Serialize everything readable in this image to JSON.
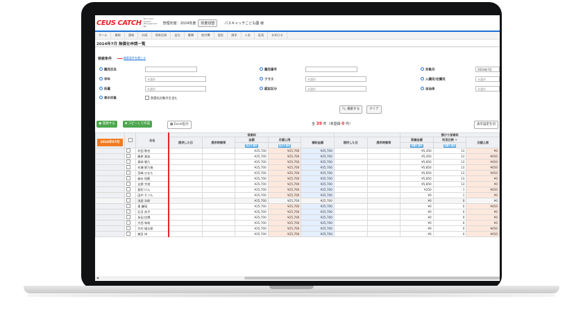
{
  "header": {
    "logo_text": "CEUS CATCH",
    "logo_subtitle": "Nice Care System Management Bit",
    "period_label": "管理年度：2024年度",
    "switch_button": "年度切替",
    "school_name": "パスキャッチこども園 様"
  },
  "nav": [
    "ホーム",
    "業務",
    "連絡",
    "計画",
    "保育記録",
    "出欠",
    "書類",
    "給付費",
    "設定",
    "請求",
    "入金",
    "延長",
    "お知らせ"
  ],
  "page_title": "2024年7月 無償化申請一覧",
  "conditions": {
    "heading": "検索条件",
    "toggle_link": "検索条件を閉じる",
    "fields": [
      {
        "label": "園児氏名",
        "value": ""
      },
      {
        "label": "園児番号",
        "value": ""
      },
      {
        "label": "対象月",
        "value": "2024年7月"
      },
      {
        "label": "学年",
        "value": "未選択"
      },
      {
        "label": "クラス",
        "value": "未選択"
      },
      {
        "label": "入園児/在園児",
        "value": "未選択"
      },
      {
        "label": "所属",
        "value": "未選択"
      },
      {
        "label": "認定区分",
        "value": "未選択"
      },
      {
        "label": "自治体",
        "value": "未選択"
      }
    ],
    "display_label": "表示対象",
    "display_checkbox": "無償化対象外を含む",
    "search_button": "検索する",
    "clear_button": "クリア"
  },
  "results": {
    "count_prefix": "全",
    "count": "39",
    "count_suffix": "件（未登録",
    "unregistered": "0",
    "count_end": "件）"
  },
  "actions": {
    "register": "登録する",
    "copy": "コピーして作成",
    "excel": "Excel出力",
    "display_settings": "表示設定を切"
  },
  "table": {
    "month_badge": "2024年07月",
    "group_headers": {
      "hoiku": "保育料",
      "azukari": "預かり保育料"
    },
    "columns": [
      "氏名",
      "提供した日",
      "提供時間帯",
      "金額",
      "月額上限",
      "補助金額",
      "提供した日",
      "提供時間帯",
      "実績金額",
      "利用日数 ÷",
      "日額上限"
    ],
    "sub_buttons": {
      "kingaku": "設定を適用",
      "gakugen": "設定を適用",
      "jisseki": "実績を適用",
      "riyou": "実績を適用"
    },
    "rows": [
      {
        "name": "村田 数也",
        "amount": "¥25,700",
        "limit": "¥25,700",
        "subsidy": "¥25,700",
        "actual": "¥5,450",
        "days": "13",
        "daily": "¥0"
      },
      {
        "name": "藤原 真苗",
        "amount": "¥25,700",
        "limit": "¥25,700",
        "subsidy": "¥25,700",
        "actual": "¥5,450",
        "days": "13",
        "daily": "¥450"
      },
      {
        "name": "青崎 朝乃",
        "amount": "¥25,700",
        "limit": "¥25,700",
        "subsidy": "¥25,700",
        "actual": "¥5,850",
        "days": "13",
        "daily": "¥450"
      },
      {
        "name": "村瀬 那乃香",
        "amount": "¥25,700",
        "limit": "¥25,700",
        "subsidy": "¥25,700",
        "actual": "¥5,850",
        "days": "13",
        "daily": "¥450"
      },
      {
        "name": "宮嶋 ひなた",
        "amount": "¥25,700",
        "limit": "¥25,700",
        "subsidy": "¥25,700",
        "actual": "¥5,850",
        "days": "13",
        "daily": "¥450"
      },
      {
        "name": "森永 拓範",
        "amount": "¥25,700",
        "limit": "¥25,700",
        "subsidy": "¥25,700",
        "actual": "¥5,850",
        "days": "13",
        "daily": "¥0"
      },
      {
        "name": "吉野 大地",
        "amount": "¥25,700",
        "limit": "¥25,700",
        "subsidy": "¥25,700",
        "actual": "¥5,850",
        "days": "13",
        "daily": "¥0"
      },
      {
        "name": "愛紀 けん",
        "amount": "¥25,700",
        "limit": "¥25,700",
        "subsidy": "¥25,700",
        "actual": "¥250",
        "days": "1",
        "daily": "¥450"
      },
      {
        "name": "田中 そうた",
        "amount": "¥25,700",
        "limit": "¥25,700",
        "subsidy": "¥25,700",
        "actual": "¥0",
        "days": "1",
        "daily": "¥0"
      },
      {
        "name": "浅居 次郎",
        "amount": "¥25,700",
        "limit": "¥25,700",
        "subsidy": "¥25,700",
        "actual": "¥0",
        "days": "0",
        "daily": "¥0"
      },
      {
        "name": "東 麗璃",
        "amount": "¥25,700",
        "limit": "¥25,700",
        "subsidy": "¥25,700",
        "actual": "¥0",
        "days": "0",
        "daily": "¥450"
      },
      {
        "name": "石月 良子",
        "amount": "¥25,700",
        "limit": "¥25,700",
        "subsidy": "¥25,700",
        "actual": "¥0",
        "days": "0",
        "daily": "¥0"
      },
      {
        "name": "多田 信博",
        "amount": "¥25,700",
        "limit": "¥25,700",
        "subsidy": "¥25,700",
        "actual": "¥0",
        "days": "0",
        "daily": "¥0"
      },
      {
        "name": "大西 和哉",
        "amount": "¥25,700",
        "limit": "¥25,700",
        "subsidy": "¥25,700",
        "actual": "¥0",
        "days": "0",
        "daily": "¥0"
      },
      {
        "name": "大村 瑠太郎",
        "amount": "¥25,700",
        "limit": "¥25,700",
        "subsidy": "¥25,700",
        "actual": "¥0",
        "days": "0",
        "daily": "¥450"
      },
      {
        "name": "美吾 侍",
        "amount": "¥25,700",
        "limit": "¥25,700",
        "subsidy": "¥25,700",
        "actual": "¥0",
        "days": "0",
        "daily": "¥450"
      }
    ]
  }
}
